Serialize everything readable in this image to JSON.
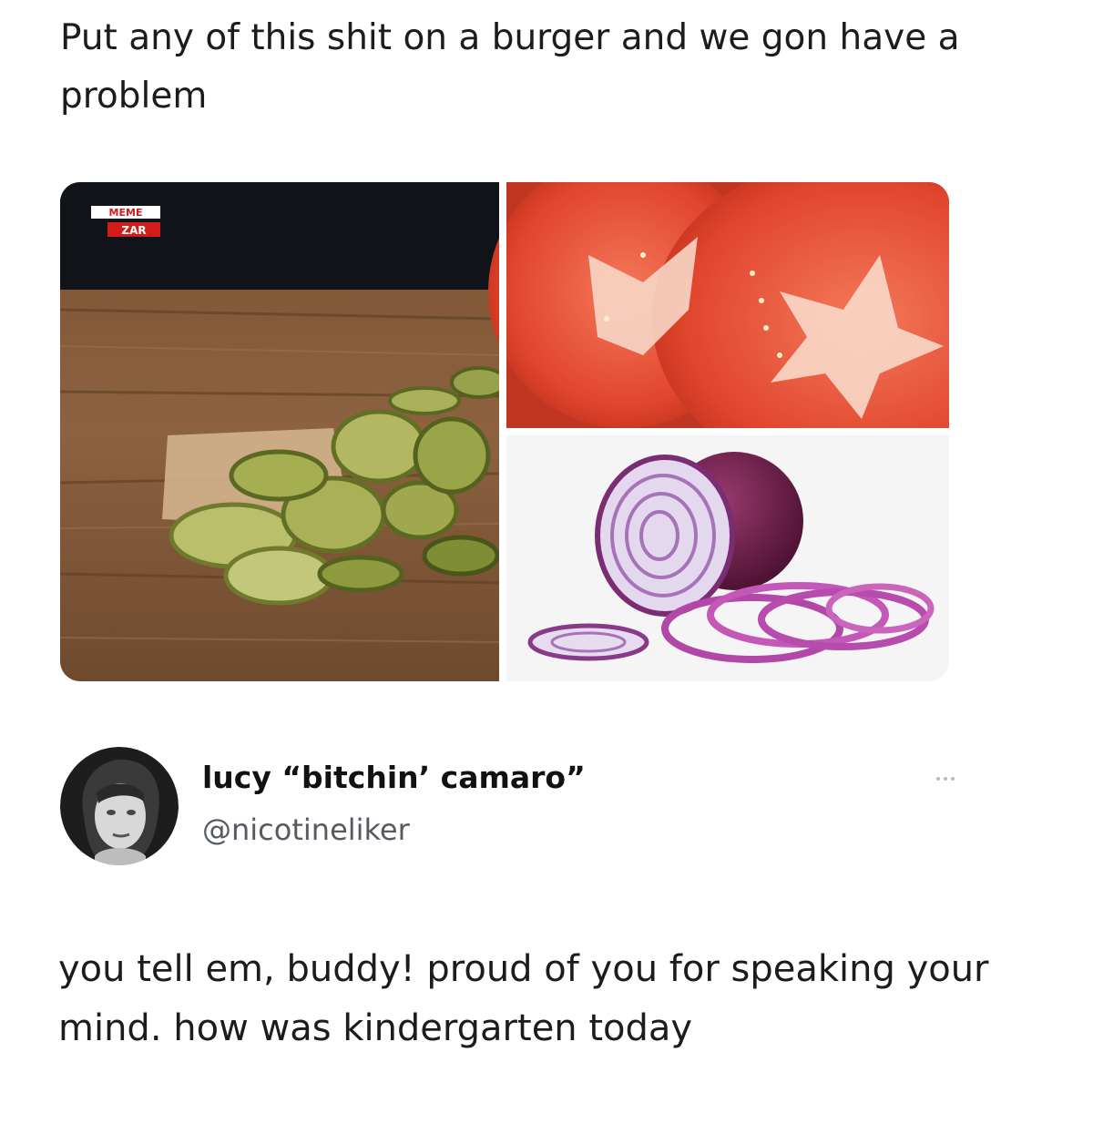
{
  "quoted_post": {
    "text": "Put any of this shit on a burger and we gon have a problem",
    "images": [
      {
        "name": "pickles-image",
        "watermark": "MEME ZAR"
      },
      {
        "name": "tomato-image"
      },
      {
        "name": "onion-image"
      }
    ]
  },
  "reply": {
    "author": {
      "display_name": "lucy “bitchin’ camaro”",
      "handle": "@nicotineliker"
    },
    "more_icon": "more-horizontal-icon",
    "text": "you tell em, buddy! proud of you for speaking your mind. how was kindergarten today"
  }
}
